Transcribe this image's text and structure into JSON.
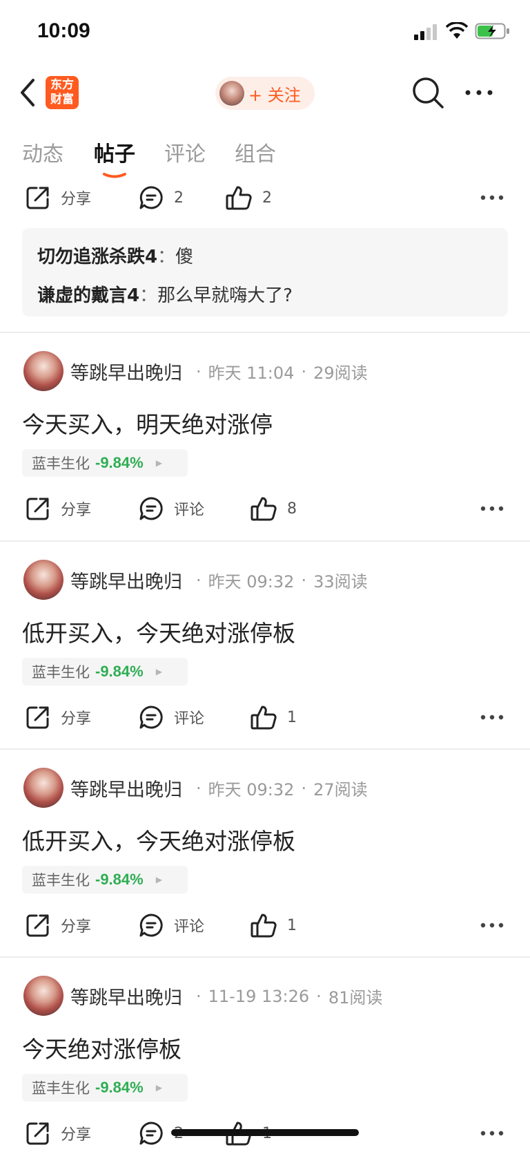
{
  "status": {
    "time": "10:09"
  },
  "header": {
    "logo_line1": "东方",
    "logo_line2": "财富",
    "follow_label": "+ 关注"
  },
  "tabs": [
    "动态",
    "帖子",
    "评论",
    "组合"
  ],
  "top_actions": {
    "share": "分享",
    "comments": "2",
    "likes": "2"
  },
  "comments": [
    {
      "author": "切勿追涨杀跌4",
      "text": "傻"
    },
    {
      "author": "谦虚的戴言4",
      "text": "那么早就嗨大了?"
    }
  ],
  "posts": [
    {
      "author": "等跳早出晚归",
      "time": "昨天 11:04",
      "reads": "29阅读",
      "title": "今天买入，明天绝对涨停",
      "stock": "蓝丰生化",
      "change": "-9.84%",
      "share": "分享",
      "comment": "评论",
      "likes": "8"
    },
    {
      "author": "等跳早出晚归",
      "time": "昨天 09:32",
      "reads": "33阅读",
      "title": "低开买入，今天绝对涨停板",
      "stock": "蓝丰生化",
      "change": "-9.84%",
      "share": "分享",
      "comment": "评论",
      "likes": "1"
    },
    {
      "author": "等跳早出晚归",
      "time": "昨天 09:32",
      "reads": "27阅读",
      "title": "低开买入，今天绝对涨停板",
      "stock": "蓝丰生化",
      "change": "-9.84%",
      "share": "分享",
      "comment": "评论",
      "likes": "1"
    },
    {
      "author": "等跳早出晚归",
      "time": "11-19 13:26",
      "reads": "81阅读",
      "title": "今天绝对涨停板",
      "stock": "蓝丰生化",
      "change": "-9.84%",
      "share": "分享",
      "comment": "2",
      "likes": "1"
    }
  ],
  "colors": {
    "accent": "#ff5a1f",
    "stock_down": "#2fae52"
  }
}
